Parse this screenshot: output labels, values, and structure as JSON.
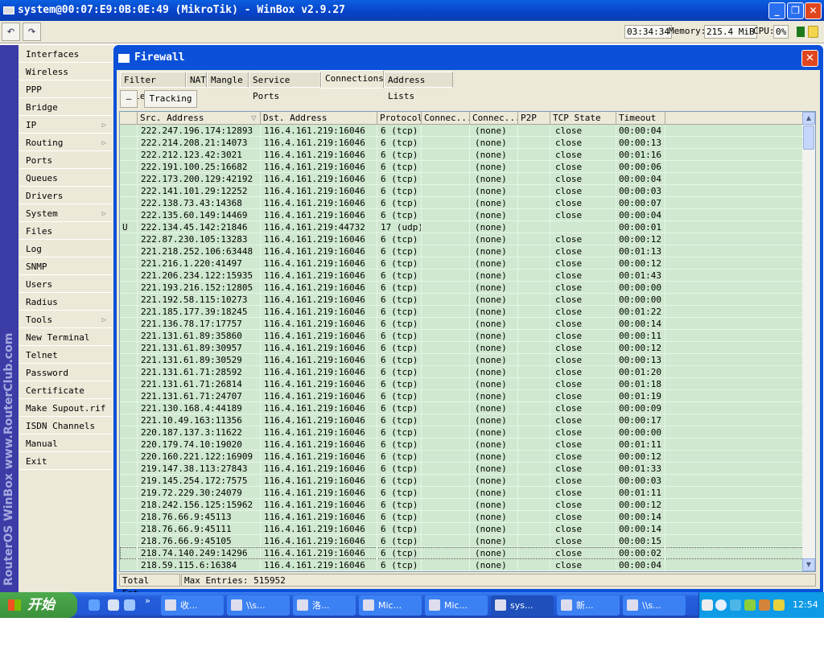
{
  "window": {
    "title": "system@00:07:E9:0B:0E:49 (MikroTik) - WinBox v2.9.27",
    "minimize": "_",
    "maximize": "❐",
    "close": "✕"
  },
  "toolbar": {
    "undo": "↶",
    "redo": "↷",
    "time": "03:34:34",
    "memory_label": "Memory:",
    "memory": "215.4 MiB",
    "cpu_label": "CPU:",
    "cpu": "0%"
  },
  "sidebar_brand": "RouterOS WinBox   www.RouterClub.com",
  "menu": [
    {
      "label": "Interfaces"
    },
    {
      "label": "Wireless"
    },
    {
      "label": "PPP"
    },
    {
      "label": "Bridge"
    },
    {
      "label": "IP",
      "arrow": "▷"
    },
    {
      "label": "Routing",
      "arrow": "▷"
    },
    {
      "label": "Ports"
    },
    {
      "label": "Queues"
    },
    {
      "label": "Drivers"
    },
    {
      "label": "System",
      "arrow": "▷"
    },
    {
      "label": "Files"
    },
    {
      "label": "Log"
    },
    {
      "label": "SNMP"
    },
    {
      "label": "Users"
    },
    {
      "label": "Radius"
    },
    {
      "label": "Tools",
      "arrow": "▷"
    },
    {
      "label": "New Terminal"
    },
    {
      "label": "Telnet"
    },
    {
      "label": "Password"
    },
    {
      "label": "Certificate"
    },
    {
      "label": "Make Supout.rif"
    },
    {
      "label": "ISDN Channels"
    },
    {
      "label": "Manual"
    },
    {
      "label": "Exit"
    }
  ],
  "firewall": {
    "title": "Firewall",
    "close": "✕",
    "tabs": [
      {
        "label": "Filter Rules"
      },
      {
        "label": "NAT"
      },
      {
        "label": "Mangle"
      },
      {
        "label": "Service Ports"
      },
      {
        "label": "Connections",
        "active": true
      },
      {
        "label": "Address Lists"
      }
    ],
    "remove_button": "—",
    "tracking_button": "Tracking",
    "columns": [
      "",
      "Src. Address",
      "Dst. Address",
      "Protocol",
      "Connec...",
      "Connec...",
      "P2P",
      "TCP State",
      "Timeout"
    ],
    "sort_indicator": "▽",
    "rows": [
      [
        "",
        "222.247.196.174:12893",
        "116.4.161.219:16046",
        "6 (tcp)",
        "",
        "(none)",
        "",
        "close",
        "00:00:04"
      ],
      [
        "",
        "222.214.208.21:14073",
        "116.4.161.219:16046",
        "6 (tcp)",
        "",
        "(none)",
        "",
        "close",
        "00:00:13"
      ],
      [
        "",
        "222.212.123.42:3021",
        "116.4.161.219:16046",
        "6 (tcp)",
        "",
        "(none)",
        "",
        "close",
        "00:01:16"
      ],
      [
        "",
        "222.191.100.25:16682",
        "116.4.161.219:16046",
        "6 (tcp)",
        "",
        "(none)",
        "",
        "close",
        "00:00:06"
      ],
      [
        "",
        "222.173.200.129:42192",
        "116.4.161.219:16046",
        "6 (tcp)",
        "",
        "(none)",
        "",
        "close",
        "00:00:04"
      ],
      [
        "",
        "222.141.101.29:12252",
        "116.4.161.219:16046",
        "6 (tcp)",
        "",
        "(none)",
        "",
        "close",
        "00:00:03"
      ],
      [
        "",
        "222.138.73.43:14368",
        "116.4.161.219:16046",
        "6 (tcp)",
        "",
        "(none)",
        "",
        "close",
        "00:00:07"
      ],
      [
        "",
        "222.135.60.149:14469",
        "116.4.161.219:16046",
        "6 (tcp)",
        "",
        "(none)",
        "",
        "close",
        "00:00:04"
      ],
      [
        "U",
        "222.134.45.142:21846",
        "116.4.161.219:44732",
        "17 (udp)",
        "",
        "(none)",
        "",
        "",
        "00:00:01"
      ],
      [
        "",
        "222.87.230.105:13283",
        "116.4.161.219:16046",
        "6 (tcp)",
        "",
        "(none)",
        "",
        "close",
        "00:00:12"
      ],
      [
        "",
        "221.218.252.106:63448",
        "116.4.161.219:16046",
        "6 (tcp)",
        "",
        "(none)",
        "",
        "close",
        "00:01:13"
      ],
      [
        "",
        "221.216.1.220:41497",
        "116.4.161.219:16046",
        "6 (tcp)",
        "",
        "(none)",
        "",
        "close",
        "00:00:12"
      ],
      [
        "",
        "221.206.234.122:15935",
        "116.4.161.219:16046",
        "6 (tcp)",
        "",
        "(none)",
        "",
        "close",
        "00:01:43"
      ],
      [
        "",
        "221.193.216.152:12805",
        "116.4.161.219:16046",
        "6 (tcp)",
        "",
        "(none)",
        "",
        "close",
        "00:00:00"
      ],
      [
        "",
        "221.192.58.115:10273",
        "116.4.161.219:16046",
        "6 (tcp)",
        "",
        "(none)",
        "",
        "close",
        "00:00:00"
      ],
      [
        "",
        "221.185.177.39:18245",
        "116.4.161.219:16046",
        "6 (tcp)",
        "",
        "(none)",
        "",
        "close",
        "00:01:22"
      ],
      [
        "",
        "221.136.78.17:17757",
        "116.4.161.219:16046",
        "6 (tcp)",
        "",
        "(none)",
        "",
        "close",
        "00:00:14"
      ],
      [
        "",
        "221.131.61.89:35860",
        "116.4.161.219:16046",
        "6 (tcp)",
        "",
        "(none)",
        "",
        "close",
        "00:00:11"
      ],
      [
        "",
        "221.131.61.89:30957",
        "116.4.161.219:16046",
        "6 (tcp)",
        "",
        "(none)",
        "",
        "close",
        "00:00:12"
      ],
      [
        "",
        "221.131.61.89:30529",
        "116.4.161.219:16046",
        "6 (tcp)",
        "",
        "(none)",
        "",
        "close",
        "00:00:13"
      ],
      [
        "",
        "221.131.61.71:28592",
        "116.4.161.219:16046",
        "6 (tcp)",
        "",
        "(none)",
        "",
        "close",
        "00:01:20"
      ],
      [
        "",
        "221.131.61.71:26814",
        "116.4.161.219:16046",
        "6 (tcp)",
        "",
        "(none)",
        "",
        "close",
        "00:01:18"
      ],
      [
        "",
        "221.131.61.71:24707",
        "116.4.161.219:16046",
        "6 (tcp)",
        "",
        "(none)",
        "",
        "close",
        "00:01:19"
      ],
      [
        "",
        "221.130.168.4:44189",
        "116.4.161.219:16046",
        "6 (tcp)",
        "",
        "(none)",
        "",
        "close",
        "00:00:09"
      ],
      [
        "",
        "221.10.49.163:11356",
        "116.4.161.219:16046",
        "6 (tcp)",
        "",
        "(none)",
        "",
        "close",
        "00:00:17"
      ],
      [
        "",
        "220.187.137.3:11622",
        "116.4.161.219:16046",
        "6 (tcp)",
        "",
        "(none)",
        "",
        "close",
        "00:00:00"
      ],
      [
        "",
        "220.179.74.10:19020",
        "116.4.161.219:16046",
        "6 (tcp)",
        "",
        "(none)",
        "",
        "close",
        "00:01:11"
      ],
      [
        "",
        "220.160.221.122:16909",
        "116.4.161.219:16046",
        "6 (tcp)",
        "",
        "(none)",
        "",
        "close",
        "00:00:12"
      ],
      [
        "",
        "219.147.38.113:27843",
        "116.4.161.219:16046",
        "6 (tcp)",
        "",
        "(none)",
        "",
        "close",
        "00:01:33"
      ],
      [
        "",
        "219.145.254.172:7575",
        "116.4.161.219:16046",
        "6 (tcp)",
        "",
        "(none)",
        "",
        "close",
        "00:00:03"
      ],
      [
        "",
        "219.72.229.30:24079",
        "116.4.161.219:16046",
        "6 (tcp)",
        "",
        "(none)",
        "",
        "close",
        "00:01:11"
      ],
      [
        "",
        "218.242.156.125:15962",
        "116.4.161.219:16046",
        "6 (tcp)",
        "",
        "(none)",
        "",
        "close",
        "00:00:12"
      ],
      [
        "",
        "218.76.66.9:45113",
        "116.4.161.219:16046",
        "6 (tcp)",
        "",
        "(none)",
        "",
        "close",
        "00:00:14"
      ],
      [
        "",
        "218.76.66.9:45111",
        "116.4.161.219:16046",
        "6 (tcp)",
        "",
        "(none)",
        "",
        "close",
        "00:00:14"
      ],
      [
        "",
        "218.76.66.9:45105",
        "116.4.161.219:16046",
        "6 (tcp)",
        "",
        "(none)",
        "",
        "close",
        "00:00:15"
      ],
      [
        "",
        "218.74.140.249:14296",
        "116.4.161.219:16046",
        "6 (tcp)",
        "",
        "(none)",
        "",
        "close",
        "00:00:02"
      ],
      [
        "",
        "218.59.115.6:16384",
        "116.4.161.219:16046",
        "6 (tcp)",
        "",
        "(none)",
        "",
        "close",
        "00:00:04"
      ]
    ],
    "status": {
      "total": "Total Ent...",
      "max": "Max Entries: 515952"
    }
  },
  "taskbar": {
    "start": "开始",
    "chevron": "»",
    "tasks": [
      "收...",
      "\\\\s...",
      "洛...",
      "Mic...",
      "Mic...",
      "sys...",
      "新...",
      "\\\\s..."
    ],
    "active_task": 5,
    "clock": "12:54"
  }
}
